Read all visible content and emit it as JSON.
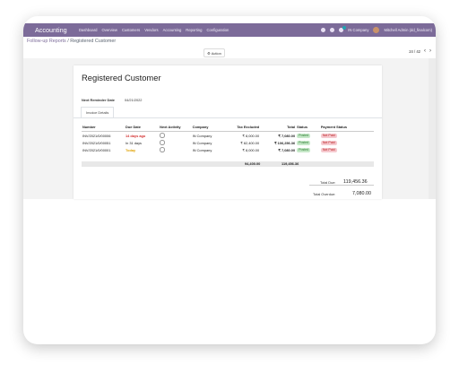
{
  "navbar": {
    "brand": "Accounting",
    "menu": [
      "Dashboard",
      "Overview",
      "Customers",
      "Vendors",
      "Accounting",
      "Reporting",
      "Configuration"
    ],
    "company": "IN Company",
    "user": "Mitchell Admin (dd_finalcom)"
  },
  "control": {
    "breadcrumb_parent": "Follow-up Reports",
    "breadcrumb_sep": " / ",
    "breadcrumb_current": "Registered Customer",
    "action_label": "Action",
    "pager": "24 / 42"
  },
  "record": {
    "title": "Registered Customer",
    "reminder_label": "Next Reminder Date",
    "reminder_value": "04/21/2022",
    "tab_label": "Invoice Details"
  },
  "table": {
    "headers": [
      "Number",
      "Due Date",
      "Next Activity",
      "Company",
      "Tax Excluded",
      "Total",
      "Status",
      "Payment Status"
    ],
    "rows": [
      {
        "number": "INV/2021/0/00006",
        "due": "14 days ago",
        "company": "IN Company",
        "tax_excluded": "₹ 8,000.00",
        "total": "₹ 7,080.00",
        "status": "Posted",
        "payment": "Not Paid"
      },
      {
        "number": "INV/2021/0/00051",
        "due": "In 31 days",
        "company": "IN Company",
        "tax_excluded": "₹ 82,400.00",
        "total": "₹ 106,256.36",
        "status": "Posted",
        "payment": "Not Paid"
      },
      {
        "number": "INV/2021/0/00001",
        "due": "Today",
        "company": "IN Company",
        "tax_excluded": "₹ 8,000.00",
        "total": "₹ 7,080.00",
        "status": "Posted",
        "payment": "Not Paid"
      }
    ],
    "sum_tax_excluded": "94,400.00",
    "sum_total": "119,456.36"
  },
  "summary": {
    "total_due_label": "Total Due:",
    "total_due_value": "119,456.36",
    "total_overdue_label": "Total Overdue:",
    "total_overdue_value": "7,080.00"
  },
  "colors": {
    "navbar": "#7c6b99",
    "overdue": "#d32f2f",
    "today": "#e0a100",
    "posted_badge": "#c6e8c8",
    "not_paid_badge": "#f6c9cf"
  }
}
